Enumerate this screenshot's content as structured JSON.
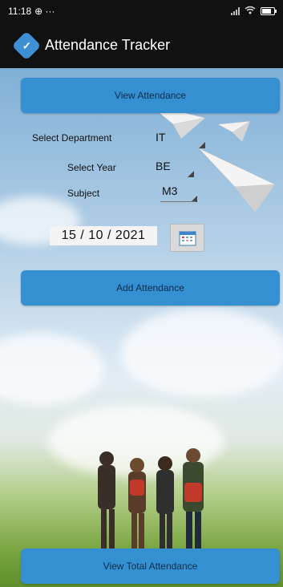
{
  "status_bar": {
    "time": "11:18",
    "extra": "⊕ ···"
  },
  "app": {
    "title": "Attendance Tracker"
  },
  "buttons": {
    "view_attendance": "View Attendance",
    "add_attendance": "Add Attendance",
    "view_total_attendance": "View Total Attendance"
  },
  "form": {
    "department": {
      "label": "Select Department",
      "value": "IT"
    },
    "year": {
      "label": "Select Year",
      "value": "BE"
    },
    "subject": {
      "label": "Subject",
      "value": "M3"
    },
    "date": "15 / 10 / 2021"
  },
  "colors": {
    "button": "#3590d2",
    "appbar": "#111111",
    "logo": "#3e8fd4"
  },
  "icons": [
    "wifi-icon",
    "signal-icon",
    "battery-icon",
    "app-logo-icon",
    "calendar-icon"
  ]
}
